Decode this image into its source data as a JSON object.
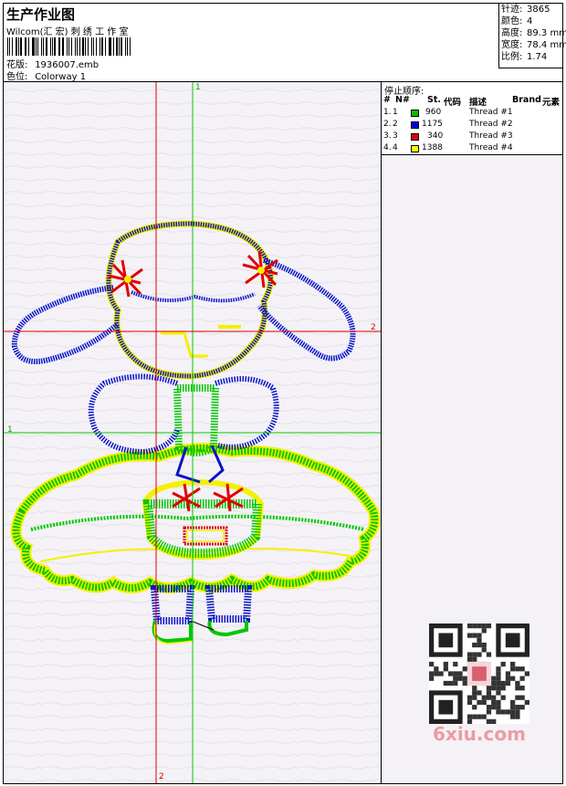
{
  "header": {
    "title": "生产作业图",
    "company": "Wilcom(汇 宏) 刺 绣 工 作 室",
    "design_label": "花版:",
    "design_value": "1936007.emb",
    "colorway_label": "色位:",
    "colorway_value": "Colorway 1"
  },
  "stats": [
    {
      "label": "针迹:",
      "value": "3865"
    },
    {
      "label": "颜色:",
      "value": "4"
    },
    {
      "label": "高度:",
      "value": "89.3 mm"
    },
    {
      "label": "宽度:",
      "value": "78.4 mm"
    },
    {
      "label": "比例:",
      "value": "1.74"
    }
  ],
  "stop_sequence": {
    "caption": "停止顺序:",
    "headers": {
      "num": "#",
      "n": "N#",
      "st": "St.",
      "code": "代码",
      "desc": "描述",
      "brand": "Brand",
      "element": "元素"
    },
    "rows": [
      {
        "num": "1.",
        "n": "1",
        "st": "960",
        "color": "#00c000",
        "desc": "Thread #1"
      },
      {
        "num": "2.",
        "n": "2",
        "st": "1175",
        "color": "#0000e0",
        "desc": "Thread #2"
      },
      {
        "num": "3.",
        "n": "3",
        "st": "340",
        "color": "#e00000",
        "desc": "Thread #3"
      },
      {
        "num": "4.",
        "n": "4",
        "st": "1388",
        "color": "#ffff00",
        "desc": "Thread #4"
      }
    ]
  },
  "axes": {
    "green_label": "1",
    "red_label": "2"
  },
  "watermark": "6xiu.com",
  "colors": {
    "green": "#00c800",
    "blue": "#0a14c8",
    "red": "#e00000",
    "yellow": "#f5f000",
    "guide_green": "#00cc00",
    "guide_red": "#e00000"
  }
}
